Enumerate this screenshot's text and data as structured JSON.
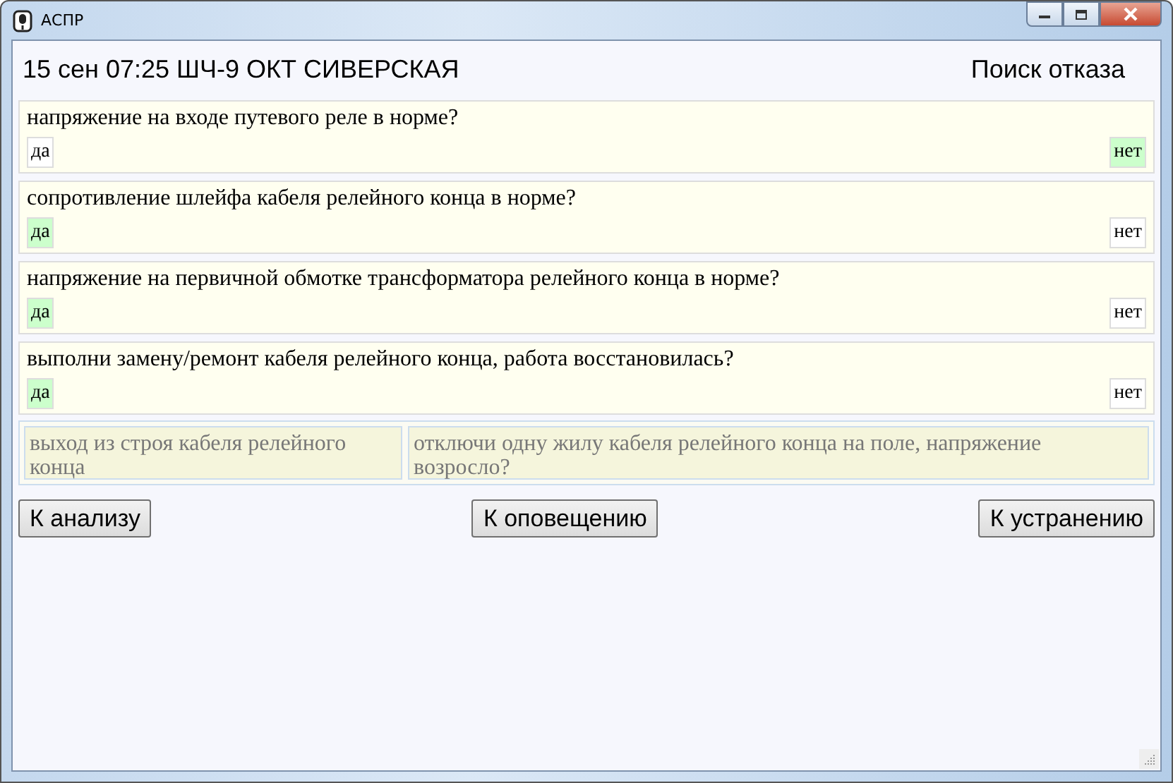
{
  "window": {
    "title": "АСПР"
  },
  "header": {
    "info": "15 сен 07:25 ШЧ-9 ОКТ СИВЕРСКАЯ",
    "mode": "Поиск отказа"
  },
  "questions": [
    {
      "text": "напряжение на входе путевого реле в норме?",
      "answers": [
        {
          "label": "да",
          "selected": false
        },
        {
          "label": "нет",
          "selected": true
        }
      ]
    },
    {
      "text": "сопротивление шлейфа кабеля релейного конца в норме?",
      "answers": [
        {
          "label": "да",
          "selected": true
        },
        {
          "label": "нет",
          "selected": false
        }
      ]
    },
    {
      "text": "напряжение на первичной обмотке трансформатора релейного конца в норме?",
      "answers": [
        {
          "label": "да",
          "selected": true
        },
        {
          "label": "нет",
          "selected": false
        }
      ]
    },
    {
      "text": "выполни замену/ремонт кабеля релейного конца, работа восстановилась?",
      "answers": [
        {
          "label": "да",
          "selected": true
        },
        {
          "label": "нет",
          "selected": false
        }
      ]
    }
  ],
  "suggestions": [
    "выход из строя кабеля релейного конца",
    "отключи одну жилу кабеля релейного конца на поле, напряжение возросло?"
  ],
  "buttons": [
    "К анализу",
    "К оповещению",
    "К устранению"
  ]
}
